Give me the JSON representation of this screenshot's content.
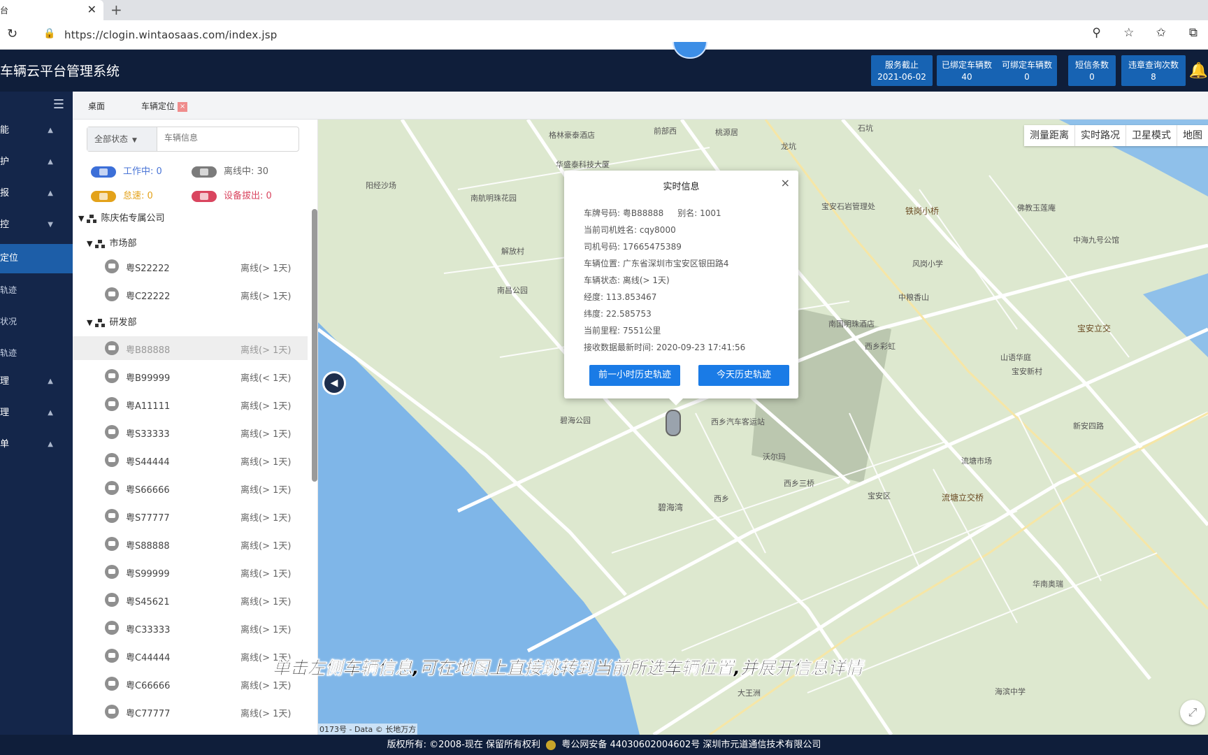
{
  "browser": {
    "tab_title": "台",
    "tab_close": "✕",
    "new_tab": "+",
    "url": "https://clogin.wintaosaas.com/index.jsp"
  },
  "app": {
    "title": "车辆云平台管理系统",
    "stats": [
      {
        "label": "服务截止",
        "value": "2021-06-02"
      },
      {
        "label": "已绑定车辆数",
        "value": "40"
      },
      {
        "label": "可绑定车辆数",
        "value": "0"
      },
      {
        "label": "短信条数",
        "value": "0"
      },
      {
        "label": "违章查询次数",
        "value": "8"
      }
    ]
  },
  "sidebar": {
    "items": [
      {
        "label": "能",
        "arrow": "▲"
      },
      {
        "label": "护",
        "arrow": "▲"
      },
      {
        "label": "报",
        "arrow": "▲"
      },
      {
        "label": "控",
        "arrow": "▼"
      },
      {
        "label": "定位",
        "arrow": ""
      },
      {
        "label": "轨迹",
        "arrow": ""
      },
      {
        "label": "状况",
        "arrow": ""
      },
      {
        "label": "轨迹",
        "arrow": ""
      },
      {
        "label": "理",
        "arrow": "▲"
      },
      {
        "label": "理",
        "arrow": "▲"
      },
      {
        "label": "单",
        "arrow": "▲"
      }
    ]
  },
  "content_tabs": [
    {
      "label": "桌面"
    },
    {
      "label": "车辆定位",
      "close": "×"
    }
  ],
  "panel": {
    "status_select": "全部状态",
    "search_placeholder": "车辆信息",
    "legend": [
      {
        "label": "工作中: 0",
        "color": "#3c6fd8"
      },
      {
        "label": "离线中: 30",
        "color": "#7b7b7b"
      },
      {
        "label": "怠速: 0",
        "color": "#e3a21a"
      },
      {
        "label": "设备拔出: 0",
        "color": "#d9455f"
      }
    ],
    "company": "陈庆佑专属公司",
    "departments": [
      {
        "name": "市场部"
      },
      {
        "name": "研发部"
      }
    ],
    "market_vehicles": [
      {
        "plate": "粤S22222",
        "status": "离线(> 1天)"
      },
      {
        "plate": "粤C22222",
        "status": "离线(> 1天)"
      }
    ],
    "rd_vehicles": [
      {
        "plate": "粤B88888",
        "status": "离线(> 1天)"
      },
      {
        "plate": "粤B99999",
        "status": "离线(< 1天)"
      },
      {
        "plate": "粤A11111",
        "status": "离线(> 1天)"
      },
      {
        "plate": "粤S33333",
        "status": "离线(> 1天)"
      },
      {
        "plate": "粤S44444",
        "status": "离线(> 1天)"
      },
      {
        "plate": "粤S66666",
        "status": "离线(> 1天)"
      },
      {
        "plate": "粤S77777",
        "status": "离线(> 1天)"
      },
      {
        "plate": "粤S88888",
        "status": "离线(> 1天)"
      },
      {
        "plate": "粤S99999",
        "status": "离线(> 1天)"
      },
      {
        "plate": "粤S45621",
        "status": "离线(> 1天)"
      },
      {
        "plate": "粤C33333",
        "status": "离线(> 1天)"
      },
      {
        "plate": "粤C44444",
        "status": "离线(> 1天)"
      },
      {
        "plate": "粤C66666",
        "status": "离线(> 1天)"
      },
      {
        "plate": "粤C77777",
        "status": "离线(> 1天)"
      }
    ]
  },
  "map": {
    "controls": [
      "测量距离",
      "实时路况",
      "卫星模式",
      "地图"
    ],
    "copyright": "0173号 - Data © 长地万方",
    "labels": [
      "格林豪泰酒店",
      "前部西 ",
      "桃源居",
      "华盛泰科技大厦",
      "石坑",
      "龙坑",
      "阳经沙场",
      "南航明珠花园",
      "宝安石岩管理处",
      "铁岗小桥",
      "佛教玉莲庵",
      "中海九号公馆",
      "解放村",
      "南昌公园",
      "风岗小学",
      "中粮香山",
      "南国明珠酒店",
      "宝安立交",
      "西乡彩虹",
      "山语华庭",
      "宝安新村",
      "碧海公园",
      "西乡汽车客运站",
      "沃尔玛",
      "流塘市场",
      "流塘立交桥",
      "西乡",
      "碧海湾",
      "宝安区",
      "华南奥瑞",
      "海滨中学",
      "西乡三桥",
      "大王洲",
      "新安四路"
    ],
    "popup": {
      "title": "实时信息",
      "close": "×",
      "plate_label": "车牌号码: ",
      "plate": "粤B88888",
      "alias_label": "别名: ",
      "alias": "1001",
      "driver_label": "当前司机姓名: ",
      "driver": "cqy8000",
      "phone_label": "司机号码: ",
      "phone": "17665475389",
      "location_label": "车辆位置: ",
      "location": "广东省深圳市宝安区银田路4",
      "state_label": "车辆状态: ",
      "state": "离线(> 1天)",
      "lng_label": "经度: ",
      "lng": "113.853467",
      "lat_label": "纬度: ",
      "lat": "22.585753",
      "mileage_label": "当前里程: ",
      "mileage": "7551公里",
      "time_label": "接收数据最新时间: ",
      "time": "2020-09-23 17:41:56",
      "btn_hour": "前一小时历史轨迹",
      "btn_today": "今天历史轨迹"
    }
  },
  "overlay_caption": "单击左侧车辆信息,可在地图上直接跳转到当前所选车辆位置,并展开信息详情",
  "footer": {
    "left": "版权所有: ©2008-现在 保留所有权利",
    "right": "粤公网安备 44030602004602号 深圳市元道通信技术有限公司"
  }
}
